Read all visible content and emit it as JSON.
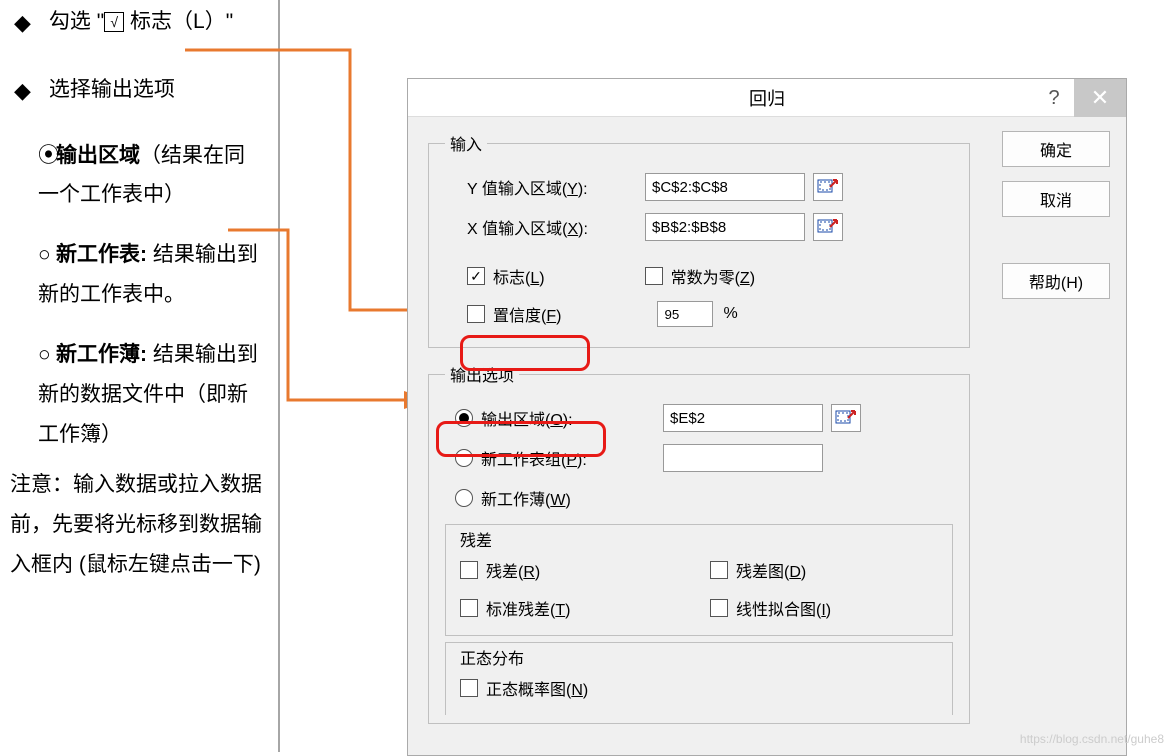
{
  "left": {
    "b1_a": "勾选 \"",
    "b1_b": " 标志（L）\"",
    "b2": "选择输出选项",
    "s1_a": "输出区域",
    "s1_b": "（结果在同一个工作表中）",
    "s2_a": "新工作表:",
    "s2_b": " 结果输出到新的工作表中。",
    "s3_a": "新工作薄:",
    "s3_b": " 结果输出到新的数据文件中（即新工作簿）",
    "note": "注意：输入数据或拉入数据前，先要将光标移到数据输入框内 (鼠标左键点击一下)"
  },
  "dialog": {
    "title": "回归",
    "ok": "确定",
    "cancel": "取消",
    "help": "帮助(H)",
    "input": {
      "legend": "输入",
      "y_label_a": "Y 值输入区域(",
      "y_label_u": "Y",
      "y_label_b": "):",
      "y_value": "$C$2:$C$8",
      "x_label_a": "X 值输入区域(",
      "x_label_u": "X",
      "x_label_b": "):",
      "x_value": "$B$2:$B$8",
      "flags_a": "标志(",
      "flags_u": "L",
      "flags_b": ")",
      "const_a": "常数为零(",
      "const_u": "Z",
      "const_b": ")",
      "conf_a": "置信度(",
      "conf_u": "F",
      "conf_b": ")",
      "conf_value": "95",
      "pct": "%"
    },
    "output": {
      "legend": "输出选项",
      "oa": "输出区域(",
      "ou": "O",
      "ob": "):",
      "ovalue": "$E$2",
      "pa": "新工作表组(",
      "pu": "P",
      "pb": "):",
      "wa": "新工作薄(",
      "wu": "W",
      "wb": ")"
    },
    "residuals": {
      "legend": "残差",
      "ra": "残差(",
      "ru": "R",
      "rb": ")",
      "da": "残差图(",
      "du": "D",
      "db": ")",
      "ta": "标准残差(",
      "tu": "T",
      "tb": ")",
      "ia": "线性拟合图(",
      "iu": "I",
      "ib": ")"
    },
    "normal": {
      "legend": "正态分布",
      "na": "正态概率图(",
      "nu": "N",
      "nb": ")"
    }
  },
  "watermark": "https://blog.csdn.net/guhe8"
}
